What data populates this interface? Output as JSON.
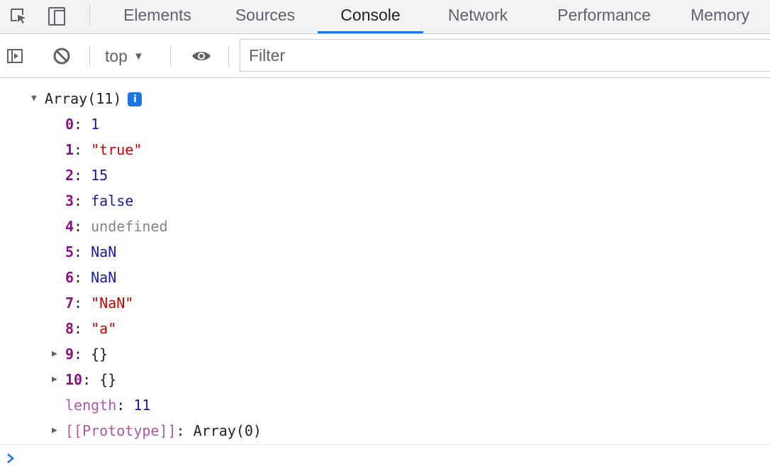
{
  "tabs": [
    {
      "label": "Elements"
    },
    {
      "label": "Sources"
    },
    {
      "label": "Console"
    },
    {
      "label": "Network"
    },
    {
      "label": "Performance"
    },
    {
      "label": "Memory"
    }
  ],
  "active_tab": "Console",
  "toolbar": {
    "context": "top",
    "filter_placeholder": "Filter"
  },
  "console": {
    "array_header": "Array(11)",
    "info_badge": "i",
    "items": [
      {
        "index": "0",
        "value": "1",
        "kind": "number"
      },
      {
        "index": "1",
        "value": "\"true\"",
        "kind": "string"
      },
      {
        "index": "2",
        "value": "15",
        "kind": "number"
      },
      {
        "index": "3",
        "value": "false",
        "kind": "boolean"
      },
      {
        "index": "4",
        "value": "undefined",
        "kind": "undefined"
      },
      {
        "index": "5",
        "value": "NaN",
        "kind": "number"
      },
      {
        "index": "6",
        "value": "NaN",
        "kind": "number"
      },
      {
        "index": "7",
        "value": "\"NaN\"",
        "kind": "string"
      },
      {
        "index": "8",
        "value": "\"a\"",
        "kind": "string"
      },
      {
        "index": "9",
        "value": "{}",
        "kind": "object"
      },
      {
        "index": "10",
        "value": "{}",
        "kind": "object"
      }
    ],
    "length_key": "length",
    "length_value": "11",
    "prototype_key": "[[Prototype]]",
    "prototype_value": "Array(0)"
  },
  "colors": {
    "accent": "#1a73e8",
    "key": "#881280",
    "string": "#c80000",
    "number": "#1a1aa6",
    "undefined": "#80868b"
  }
}
